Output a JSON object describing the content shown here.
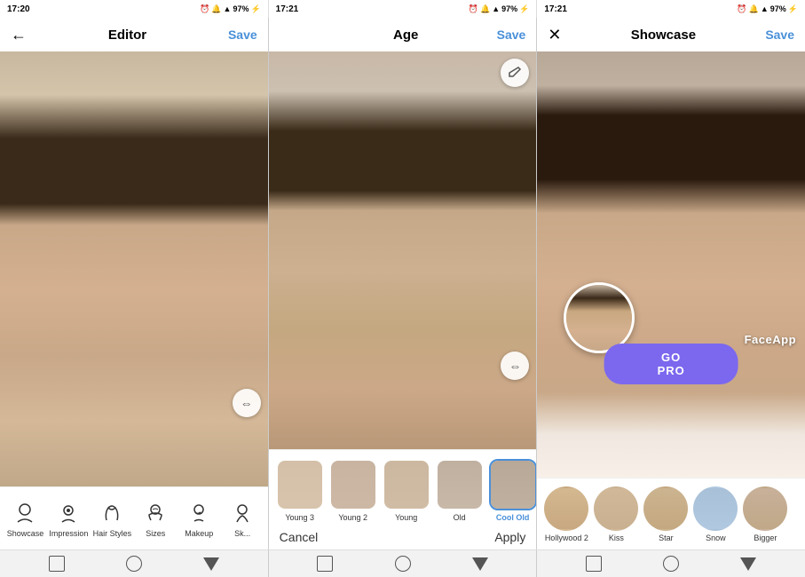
{
  "panels": [
    {
      "id": "editor",
      "time": "17:20",
      "title": "Editor",
      "save_label": "Save",
      "status": "97%",
      "toolbar_items": [
        {
          "id": "showcase",
          "label": "Showcase"
        },
        {
          "id": "impression",
          "label": "Impression"
        },
        {
          "id": "hair-styles",
          "label": "Hair Styles"
        },
        {
          "id": "sizes",
          "label": "Sizes"
        },
        {
          "id": "makeup",
          "label": "Makeup"
        },
        {
          "id": "skin",
          "label": "Sk..."
        }
      ]
    },
    {
      "id": "age",
      "time": "17:21",
      "title": "Age",
      "save_label": "Save",
      "status": "97%",
      "age_filters": [
        {
          "id": "young3",
          "label": "Young 3",
          "selected": false
        },
        {
          "id": "young2",
          "label": "Young 2",
          "selected": false
        },
        {
          "id": "young",
          "label": "Young",
          "selected": false
        },
        {
          "id": "old",
          "label": "Old",
          "selected": false
        },
        {
          "id": "coolold",
          "label": "Cool Old",
          "selected": true
        }
      ],
      "cancel_label": "Cancel",
      "apply_label": "Apply"
    },
    {
      "id": "showcase",
      "time": "17:21",
      "title": "Showcase",
      "save_label": "Save",
      "status": "97%",
      "go_pro_label": "GO PRO",
      "faceapp_label": "FaceApp",
      "showcase_filters": [
        {
          "id": "hollywood2",
          "label": "Hollywood 2"
        },
        {
          "id": "kiss",
          "label": "Kiss"
        },
        {
          "id": "star",
          "label": "Star"
        },
        {
          "id": "snow",
          "label": "Snow"
        },
        {
          "id": "bigger",
          "label": "Bigger"
        }
      ]
    }
  ],
  "nav": {
    "square_label": "□",
    "circle_label": "○",
    "triangle_label": "△"
  }
}
